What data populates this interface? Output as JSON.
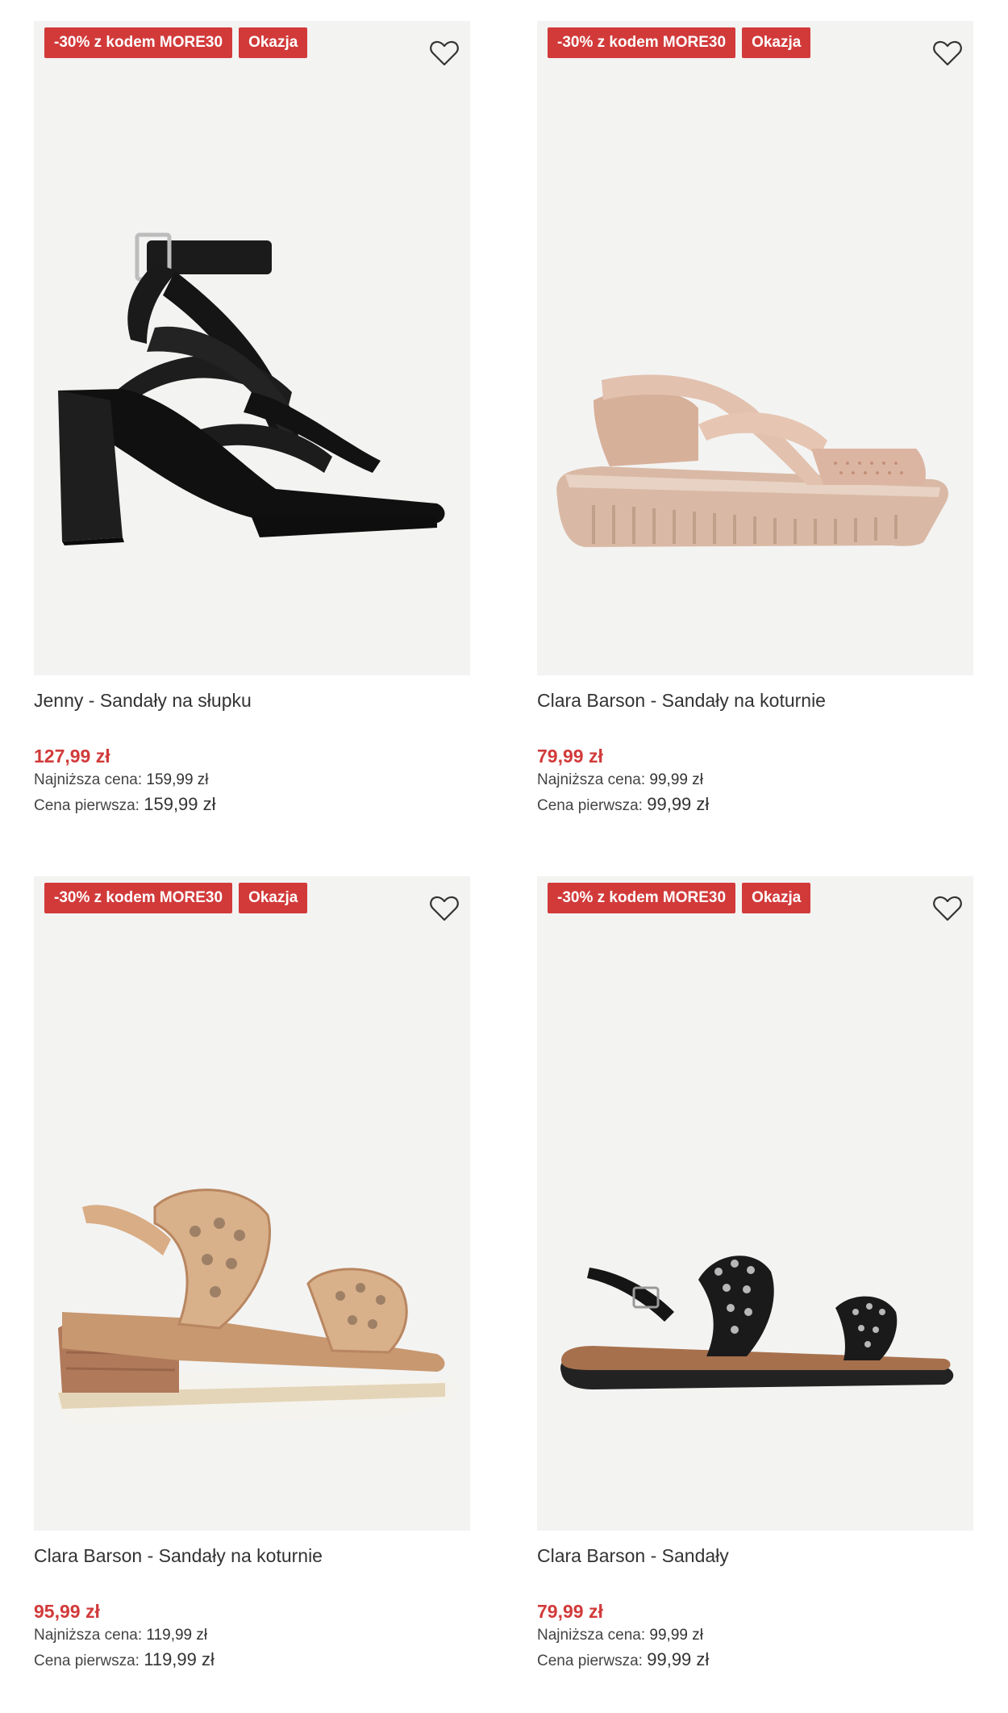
{
  "colors": {
    "badge_bg": "#d23a3a",
    "price": "#d23a3a",
    "image_bg": "#f3f3f2"
  },
  "products": [
    {
      "badge_code": "-30% z kodem MORE30",
      "badge_sale": "Okazja",
      "name": "Jenny - Sandały na słupku",
      "price": "127,99 zł",
      "lowest_label": "Najniższa cena:",
      "lowest_value": "159,99 zł",
      "first_label": "Cena pierwsza:",
      "first_value": "159,99 zł",
      "image": "black-block-heel-sandal",
      "wishlist_icon": "heart-outline-icon"
    },
    {
      "badge_code": "-30% z kodem MORE30",
      "badge_sale": "Okazja",
      "name": "Clara Barson - Sandały na koturnie",
      "price": "79,99 zł",
      "lowest_label": "Najniższa cena:",
      "lowest_value": "99,99 zł",
      "first_label": "Cena pierwsza:",
      "first_value": "99,99 zł",
      "image": "beige-wedge-sandal",
      "wishlist_icon": "heart-outline-icon"
    },
    {
      "badge_code": "-30% z kodem MORE30",
      "badge_sale": "Okazja",
      "name": "Clara Barson - Sandały na koturnie",
      "price": "95,99 zł",
      "lowest_label": "Najniższa cena:",
      "lowest_value": "119,99 zł",
      "first_label": "Cena pierwsza:",
      "first_value": "119,99 zł",
      "image": "tan-cutout-wedge-sandal",
      "wishlist_icon": "heart-outline-icon"
    },
    {
      "badge_code": "-30% z kodem MORE30",
      "badge_sale": "Okazja",
      "name": "Clara Barson - Sandały",
      "price": "79,99 zł",
      "lowest_label": "Najniższa cena:",
      "lowest_value": "99,99 zł",
      "first_label": "Cena pierwsza:",
      "first_value": "99,99 zł",
      "image": "black-embellished-flat-sandal",
      "wishlist_icon": "heart-outline-icon"
    }
  ]
}
